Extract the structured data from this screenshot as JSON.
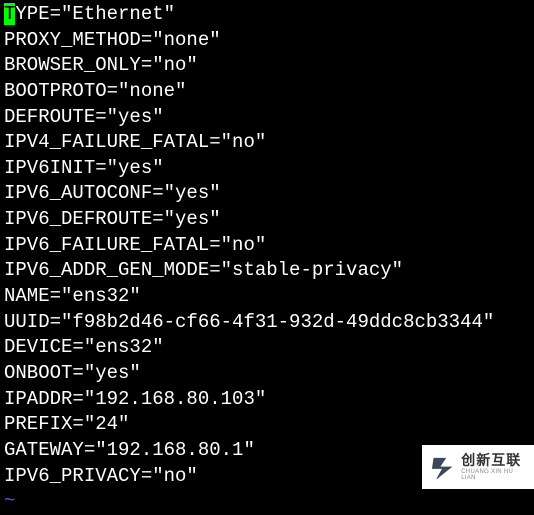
{
  "config": {
    "lines": [
      {
        "key": "TYPE",
        "value": "\"Ethernet\"",
        "first_char_cursor": true
      },
      {
        "key": "PROXY_METHOD",
        "value": "\"none\""
      },
      {
        "key": "BROWSER_ONLY",
        "value": "\"no\""
      },
      {
        "key": "BOOTPROTO",
        "value": "\"none\""
      },
      {
        "key": "DEFROUTE",
        "value": "\"yes\""
      },
      {
        "key": "IPV4_FAILURE_FATAL",
        "value": "\"no\""
      },
      {
        "key": "IPV6INIT",
        "value": "\"yes\""
      },
      {
        "key": "IPV6_AUTOCONF",
        "value": "\"yes\""
      },
      {
        "key": "IPV6_DEFROUTE",
        "value": "\"yes\""
      },
      {
        "key": "IPV6_FAILURE_FATAL",
        "value": "\"no\""
      },
      {
        "key": "IPV6_ADDR_GEN_MODE",
        "value": "\"stable-privacy\""
      },
      {
        "key": "NAME",
        "value": "\"ens32\""
      },
      {
        "key": "UUID",
        "value": "\"f98b2d46-cf66-4f31-932d-49ddc8cb3344\""
      },
      {
        "key": "DEVICE",
        "value": "\"ens32\""
      },
      {
        "key": "ONBOOT",
        "value": "\"yes\""
      },
      {
        "key": "IPADDR",
        "value": "\"192.168.80.103\""
      },
      {
        "key": "PREFIX",
        "value": "\"24\""
      },
      {
        "key": "GATEWAY",
        "value": "\"192.168.80.1\""
      },
      {
        "key": "IPV6_PRIVACY",
        "value": "\"no\""
      }
    ],
    "tilde": "~"
  },
  "watermark": {
    "cn": "创新互联",
    "en": "CHUANG XIN HU LIAN"
  }
}
